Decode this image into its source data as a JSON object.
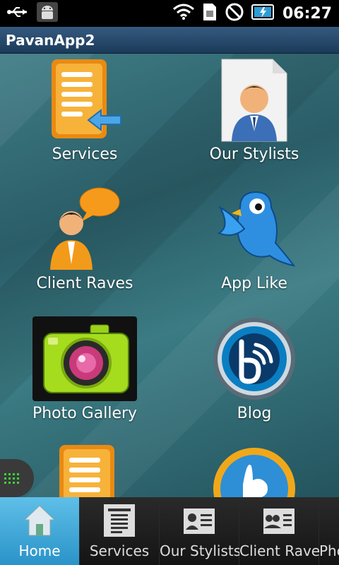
{
  "status_bar": {
    "time": "06:27"
  },
  "title_bar": {
    "title": "PavanApp2"
  },
  "grid": [
    {
      "label": "Services"
    },
    {
      "label": "Our Stylists"
    },
    {
      "label": "Client Raves"
    },
    {
      "label": "App Like"
    },
    {
      "label": "Photo Gallery"
    },
    {
      "label": "Blog"
    }
  ],
  "tabs": [
    {
      "label": "Home"
    },
    {
      "label": "Services"
    },
    {
      "label": "Our Stylists"
    },
    {
      "label": "Client Raves"
    },
    {
      "label": "Pho"
    }
  ],
  "colors": {
    "title_bar": "#2a4d72",
    "active_tab": "#3aa7db",
    "content_bg": "#3a727b"
  }
}
